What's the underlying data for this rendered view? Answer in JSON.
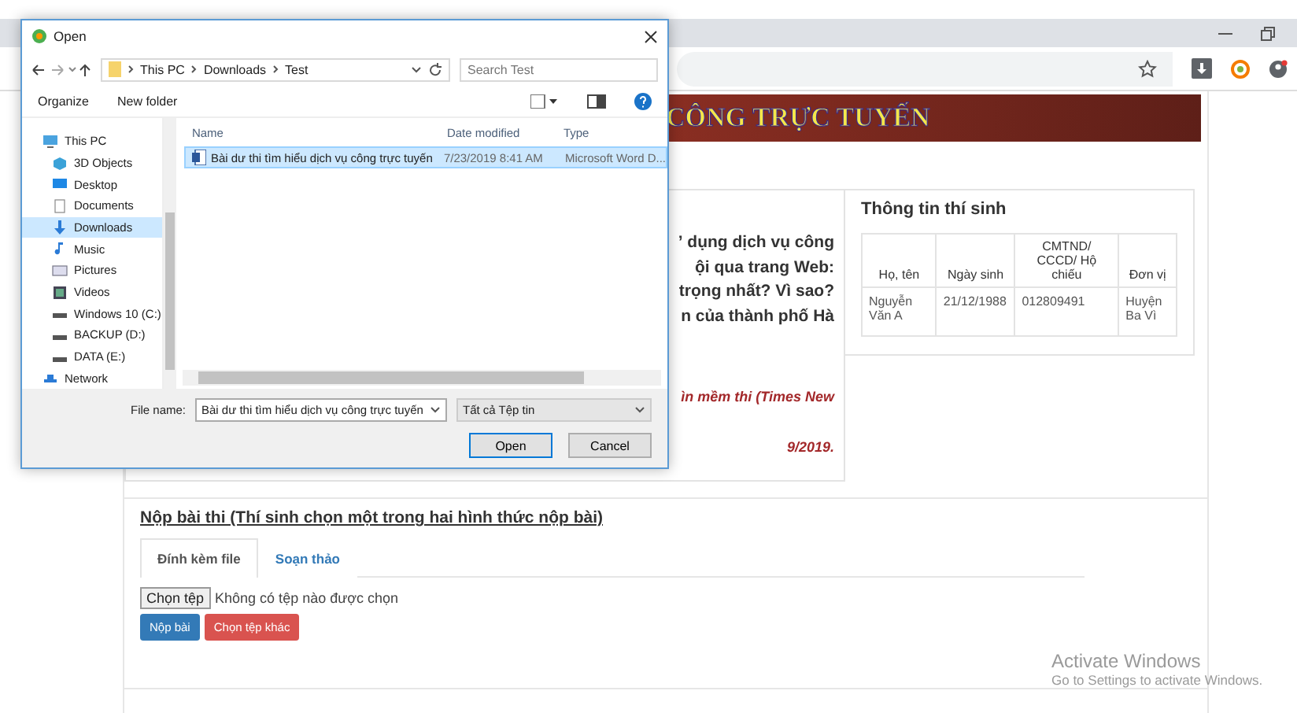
{
  "page": {
    "banner_title": "CÔNG TRỰC TUYẾN",
    "question_lines": [
      "ʼ dụng dịch vụ công",
      "ội qua trang Web:",
      "trọng nhất? Vì sao?",
      "n của thành phố Hà"
    ],
    "notes": [
      "ìn mềm thi (Times New",
      "9/2019."
    ],
    "candidate": {
      "title": "Thông tin thí sinh",
      "columns": [
        "Họ, tên",
        "Ngày sinh",
        "CMTND/ CCCD/ Hộ chiếu",
        "Đơn vị"
      ],
      "rows": [
        [
          "Nguyễn Văn A",
          "21/12/1988",
          "012809491",
          "Huyện Ba Vì"
        ]
      ]
    },
    "submit": {
      "heading": "Nộp bài thi (Thí sinh chọn một trong hai hình thức nộp bài)",
      "tabs": [
        {
          "label": "Đính kèm file",
          "selected": true
        },
        {
          "label": "Soạn thảo",
          "selected": false
        }
      ],
      "file_button": "Chọn tệp",
      "file_status": "Không có tệp nào được chọn",
      "buttons": [
        {
          "label": "Nộp bài",
          "kind": "primary"
        },
        {
          "label": "Chọn tệp khác",
          "kind": "danger"
        }
      ]
    }
  },
  "dialog": {
    "title": "Open",
    "breadcrumb": [
      "This PC",
      "Downloads",
      "Test"
    ],
    "search": {
      "placeholder": "Search Test"
    },
    "toolbar": {
      "organize": "Organize",
      "new_folder": "New folder"
    },
    "nav": [
      {
        "label": "This PC",
        "kind": "pc",
        "selected": false
      },
      {
        "label": "3D Objects",
        "kind": "cube",
        "selected": false
      },
      {
        "label": "Desktop",
        "kind": "desktop",
        "selected": false
      },
      {
        "label": "Documents",
        "kind": "doc",
        "selected": false
      },
      {
        "label": "Downloads",
        "kind": "download",
        "selected": true
      },
      {
        "label": "Music",
        "kind": "music",
        "selected": false
      },
      {
        "label": "Pictures",
        "kind": "picture",
        "selected": false
      },
      {
        "label": "Videos",
        "kind": "video",
        "selected": false
      },
      {
        "label": "Windows 10 (C:)",
        "kind": "drive",
        "selected": false
      },
      {
        "label": "BACKUP (D:)",
        "kind": "drive",
        "selected": false
      },
      {
        "label": "DATA (E:)",
        "kind": "drive",
        "selected": false
      },
      {
        "label": "Network",
        "kind": "network",
        "selected": false
      }
    ],
    "columns": [
      "Name",
      "Date modified",
      "Type"
    ],
    "files": [
      {
        "name": "Bài dư thi tìm hiểu dịch vụ công trực tuyến",
        "date": "7/23/2019 8:41 AM",
        "type": "Microsoft Word D...",
        "selected": true
      }
    ],
    "file_name_label": "File name:",
    "file_name": "Bài dư thi tìm hiểu dịch vụ công trực tuyến",
    "filter": "Tất cả Tệp tin",
    "buttons": [
      {
        "label": "Open",
        "kind": "default"
      },
      {
        "label": "Cancel",
        "kind": "normal"
      }
    ]
  },
  "watermark": {
    "title": "Activate Windows",
    "subtitle": "Go to Settings to activate Windows."
  }
}
